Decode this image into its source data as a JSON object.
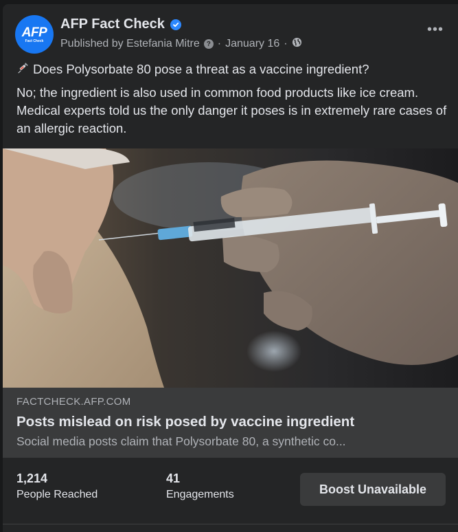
{
  "post": {
    "page_name": "AFP Fact Check",
    "avatar_logo": "AFP",
    "avatar_sub": "Fact Check",
    "published_by": "Published by Estefania Mitre",
    "date": "January 16",
    "dot": "·",
    "headline": "Does Polysorbate 80 pose a threat as a vaccine ingredient?",
    "body": "No; the ingredient is also used in common food products like ice cream. Medical experts told us the only danger it poses is in extremely rare cases of an allergic reaction.",
    "icons": {
      "verified": "verified-badge-icon",
      "help": "question-icon",
      "audience": "globe-icon",
      "menu": "more-horizontal-icon",
      "emoji": "syringe-icon"
    }
  },
  "link": {
    "domain": "FACTCHECK.AFP.COM",
    "title": "Posts mislead on risk posed by vaccine ingredient",
    "description": "Social media posts claim that Polysorbate 80, a synthetic co..."
  },
  "stats": {
    "reached_value": "1,214",
    "reached_label": "People Reached",
    "engagements_value": "41",
    "engagements_label": "Engagements",
    "boost_label": "Boost Unavailable"
  },
  "colors": {
    "background": "#242526",
    "link_box": "#3a3b3c",
    "brand": "#1877f2",
    "text": "#e4e6eb",
    "secondary_text": "#b0b3b8"
  }
}
